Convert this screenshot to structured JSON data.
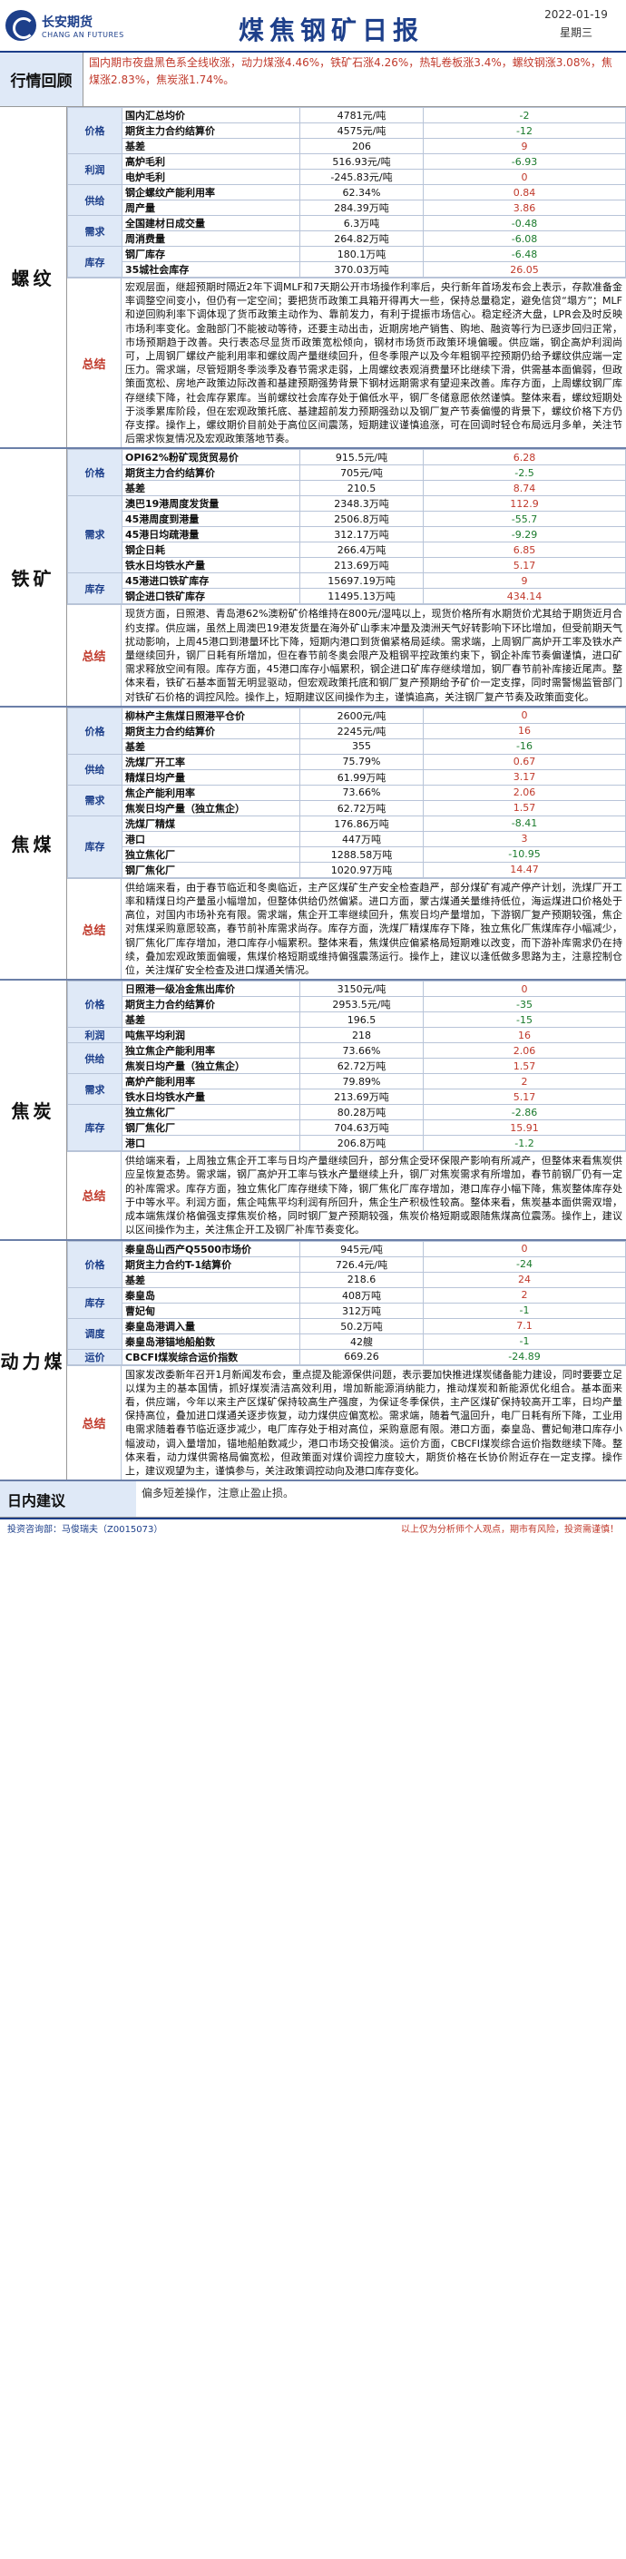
{
  "header": {
    "company_cn": "长安期货",
    "company_en": "CHANG AN FUTURES",
    "title": "煤焦钢矿日报",
    "date": "2022-01-19",
    "weekday": "星期三"
  },
  "review": {
    "label": "行情回顾",
    "text": "国内期市夜盘黑色系全线收涨，动力煤涨4.46%，铁矿石涨4.26%，热轧卷板涨3.4%，螺纹钢涨3.08%，焦煤涨2.83%，焦炭涨1.74%。"
  },
  "sections": [
    {
      "name": "螺纹",
      "rows": [
        {
          "cat": "价格",
          "name": "国内汇总均价",
          "value": "4781元/吨",
          "change": "-2"
        },
        {
          "cat": "价格",
          "name": "期货主力合约结算价",
          "value": "4575元/吨",
          "change": "-12"
        },
        {
          "cat": "价格",
          "name": "基差",
          "value": "206",
          "change": "9"
        },
        {
          "cat": "利润",
          "name": "高炉毛利",
          "value": "516.93元/吨",
          "change": "-6.93"
        },
        {
          "cat": "利润",
          "name": "电炉毛利",
          "value": "-245.83元/吨",
          "change": "0"
        },
        {
          "cat": "供给",
          "name": "钢企螺纹产能利用率",
          "value": "62.34%",
          "change": "0.84"
        },
        {
          "cat": "供给",
          "name": "周产量",
          "value": "284.39万吨",
          "change": "3.86"
        },
        {
          "cat": "需求",
          "name": "全国建材日成交量",
          "value": "6.3万吨",
          "change": "-0.48"
        },
        {
          "cat": "需求",
          "name": "周消费量",
          "value": "264.82万吨",
          "change": "-6.08"
        },
        {
          "cat": "库存",
          "name": "钢厂库存",
          "value": "180.1万吨",
          "change": "-6.48"
        },
        {
          "cat": "库存",
          "name": "35城社会库存",
          "value": "370.03万吨",
          "change": "26.05"
        }
      ],
      "summary_label": "总结",
      "summary": "宏观层面，继超预期时隔近2年下调MLF和7天期公开市场操作利率后，央行新年首场发布会上表示，存款准备金率调整空间变小，但仍有一定空间；要把货币政策工具箱开得再大一些，保持总量稳定，避免信贷“塌方”；MLF和逆回购利率下调体现了货币政策主动作为、靠前发力，有利于提振市场信心。稳定经济大盘，LPR会及时反映市场利率变化。金融部门不能被动等待，还要主动出击，近期房地产销售、购地、融资等行为已逐步回归正常，市场预期趋于改善。央行表态尽显货币政策宽松倾向，钢材市场货币政策环境偏暖。供应端，钢企高炉利润尚可，上周钢厂螺纹产能利用率和螺纹周产量继续回升，但冬季限产以及今年粗钢平控预期仍给予螺纹供应端一定压力。需求端，尽管短期冬季淡季及春节需求走弱，上周螺纹表观消费量环比继续下滑，供需基本面偏弱，但政策面宽松、房地产政策边际改善和基建预期强势背景下钢材远期需求有望迎来改善。库存方面，上周螺纹钢厂库存继续下降，社会库存累库。当前螺纹社会库存处于偏低水平，钢厂冬储意愿依然谨慎。整体来看，螺纹短期处于淡季累库阶段，但在宏观政策托底、基建超前发力预期强劲以及钢厂复产节奏偏慢的背景下，螺纹价格下方仍存支撑。操作上，螺纹期价目前处于高位区间震荡，短期建议谨慎追涨，可在回调时轻仓布局远月多单，关注节后需求恢复情况及宏观政策落地节奏。"
    },
    {
      "name": "铁矿",
      "rows": [
        {
          "cat": "价格",
          "name": "OPI62%粉矿现货贸易价",
          "value": "915.5元/吨",
          "change": "6.28"
        },
        {
          "cat": "价格",
          "name": "期货主力合约结算价",
          "value": "705元/吨",
          "change": "-2.5"
        },
        {
          "cat": "价格",
          "name": "基差",
          "value": "210.5",
          "change": "8.74"
        },
        {
          "cat": "需求",
          "name": "澳巴19港周度发货量",
          "value": "2348.3万吨",
          "change": "112.9"
        },
        {
          "cat": "需求",
          "name": "45港周度到港量",
          "value": "2506.8万吨",
          "change": "-55.7"
        },
        {
          "cat": "需求",
          "name": "45港日均疏港量",
          "value": "312.17万吨",
          "change": "-9.29"
        },
        {
          "cat": "需求",
          "name": "钢企日耗",
          "value": "266.4万吨",
          "change": "6.85"
        },
        {
          "cat": "需求",
          "name": "铁水日均铁水产量",
          "value": "213.69万吨",
          "change": "5.17"
        },
        {
          "cat": "库存",
          "name": "45港进口铁矿库存",
          "value": "15697.19万吨",
          "change": "9"
        },
        {
          "cat": "库存",
          "name": "钢企进口铁矿库存",
          "value": "11495.13万吨",
          "change": "434.14"
        }
      ],
      "summary_label": "总结",
      "summary": "现货方面，日照港、青岛港62%澳粉矿价格维持在800元/湿吨以上，现货价格所有水期货价尤其给于期货近月合约支撑。供应端，虽然上周澳巴19港发货量在海外矿山季末冲量及澳洲天气好转影响下环比增加，但受前期天气扰动影响，上周45港口到港量环比下降，短期内港口到货偏紧格局延续。需求端，上周钢厂高炉开工率及铁水产量继续回升，钢厂日耗有所增加，但在春节前冬奥会限产及粗钢平控政策约束下，钢企补库节奏偏谨慎，进口矿需求释放空间有限。库存方面，45港口库存小幅累积，钢企进口矿库存继续增加，钢厂春节前补库接近尾声。整体来看，铁矿石基本面暂无明显驱动，但宏观政策托底和钢厂复产预期给予矿价一定支撑，同时需警惕监管部门对铁矿石价格的调控风险。操作上，短期建议区间操作为主，谨慎追高，关注钢厂复产节奏及政策面变化。"
    },
    {
      "name": "焦煤",
      "rows": [
        {
          "cat": "价格",
          "name": "柳林产主焦煤日照港平仓价",
          "value": "2600元/吨",
          "change": "0"
        },
        {
          "cat": "价格",
          "name": "期货主力合约结算价",
          "value": "2245元/吨",
          "change": "16"
        },
        {
          "cat": "价格",
          "name": "基差",
          "value": "355",
          "change": "-16"
        },
        {
          "cat": "供给",
          "name": "洗煤厂开工率",
          "value": "75.79%",
          "change": "0.67"
        },
        {
          "cat": "供给",
          "name": "精煤日均产量",
          "value": "61.99万吨",
          "change": "3.17"
        },
        {
          "cat": "需求",
          "name": "焦企产能利用率",
          "value": "73.66%",
          "change": "2.06"
        },
        {
          "cat": "需求",
          "name": "焦炭日均产量（独立焦企）",
          "value": "62.72万吨",
          "change": "1.57"
        },
        {
          "cat": "库存",
          "name": "洗煤厂精煤",
          "value": "176.86万吨",
          "change": "-8.41"
        },
        {
          "cat": "库存",
          "name": "港口",
          "value": "447万吨",
          "change": "3"
        },
        {
          "cat": "库存",
          "name": "独立焦化厂",
          "value": "1288.58万吨",
          "change": "-10.95"
        },
        {
          "cat": "库存",
          "name": "钢厂焦化厂",
          "value": "1020.97万吨",
          "change": "14.47"
        }
      ],
      "summary_label": "总结",
      "summary": "供给端来看，由于春节临近和冬奥临近，主产区煤矿生产安全检查趋严，部分煤矿有减产停产计划，洗煤厂开工率和精煤日均产量虽小幅增加，但整体供给仍然偏紧。进口方面，蒙古煤通关量维持低位，海运煤进口价格处于高位，对国内市场补充有限。需求端，焦企开工率继续回升，焦炭日均产量增加，下游钢厂复产预期较强，焦企对焦煤采购意愿较高，春节前补库需求尚存。库存方面，洗煤厂精煤库存下降，独立焦化厂焦煤库存小幅减少，钢厂焦化厂库存增加，港口库存小幅累积。整体来看，焦煤供应偏紧格局短期难以改变，而下游补库需求仍在持续，叠加宏观政策面偏暖，焦煤价格短期或维持偏强震荡运行。操作上，建议以逢低做多思路为主，注意控制仓位，关注煤矿安全检查及进口煤通关情况。"
    },
    {
      "name": "焦炭",
      "rows": [
        {
          "cat": "价格",
          "name": "日照港一级冶金焦出库价",
          "value": "3150元/吨",
          "change": "0"
        },
        {
          "cat": "价格",
          "name": "期货主力合约结算价",
          "value": "2953.5元/吨",
          "change": "-35"
        },
        {
          "cat": "价格",
          "name": "基差",
          "value": "196.5",
          "change": "-15"
        },
        {
          "cat": "利润",
          "name": "吨焦平均利润",
          "value": "218",
          "change": "16"
        },
        {
          "cat": "供给",
          "name": "独立焦企产能利用率",
          "value": "73.66%",
          "change": "2.06"
        },
        {
          "cat": "供给",
          "name": "焦炭日均产量（独立焦企）",
          "value": "62.72万吨",
          "change": "1.57"
        },
        {
          "cat": "需求",
          "name": "高炉产能利用率",
          "value": "79.89%",
          "change": "2"
        },
        {
          "cat": "需求",
          "name": "铁水日均铁水产量",
          "value": "213.69万吨",
          "change": "5.17"
        },
        {
          "cat": "库存",
          "name": "独立焦化厂",
          "value": "80.28万吨",
          "change": "-2.86"
        },
        {
          "cat": "库存",
          "name": "钢厂焦化厂",
          "value": "704.63万吨",
          "change": "15.91"
        },
        {
          "cat": "库存",
          "name": "港口",
          "value": "206.8万吨",
          "change": "-1.2"
        }
      ],
      "summary_label": "总结",
      "summary": "供给端来看，上周独立焦企开工率与日均产量继续回升，部分焦企受环保限产影响有所减产，但整体来看焦炭供应呈恢复态势。需求端，钢厂高炉开工率与铁水产量继续上升，钢厂对焦炭需求有所增加，春节前钢厂仍有一定的补库需求。库存方面，独立焦化厂库存继续下降，钢厂焦化厂库存增加，港口库存小幅下降，焦炭整体库存处于中等水平。利润方面，焦企吨焦平均利润有所回升，焦企生产积极性较高。整体来看，焦炭基本面供需双增，成本端焦煤价格偏强支撑焦炭价格，同时钢厂复产预期较强，焦炭价格短期或跟随焦煤高位震荡。操作上，建议以区间操作为主，关注焦企开工及钢厂补库节奏变化。"
    },
    {
      "name": "动力煤",
      "rows": [
        {
          "cat": "价格",
          "name": "秦皇岛山西产Q5500市场价",
          "value": "945元/吨",
          "change": "0"
        },
        {
          "cat": "价格",
          "name": "期货主力合约T-1结算价",
          "value": "726.4元/吨",
          "change": "-24"
        },
        {
          "cat": "价格",
          "name": "基差",
          "value": "218.6",
          "change": "24"
        },
        {
          "cat": "库存",
          "name": "秦皇岛",
          "value": "408万吨",
          "change": "2"
        },
        {
          "cat": "库存",
          "name": "曹妃甸",
          "value": "312万吨",
          "change": "-1"
        },
        {
          "cat": "调度",
          "name": "秦皇岛港调入量",
          "value": "50.2万吨",
          "change": "7.1"
        },
        {
          "cat": "调度",
          "name": "秦皇岛港锚地船舶数",
          "value": "42艘",
          "change": "-1"
        },
        {
          "cat": "运价",
          "name": "CBCFI煤炭综合运价指数",
          "value": "669.26",
          "change": "-24.89"
        }
      ],
      "summary_label": "总结",
      "summary": "国家发改委新年召开1月新闻发布会，重点提及能源保供问题，表示要加快推进煤炭储备能力建设，同时要要立足以煤为主的基本国情，抓好煤炭清洁高效利用，增加新能源消纳能力，推动煤炭和新能源优化组合。基本面来看，供应端，今年以来主产区煤矿保持较高生产强度，为保证冬季保供，主产区煤矿保持较高开工率，日均产量保持高位，叠加进口煤通关逐步恢复，动力煤供应偏宽松。需求端，随着气温回升，电厂日耗有所下降，工业用电需求随着春节临近逐步减少，电厂库存处于相对高位，采购意愿有限。港口方面，秦皇岛、曹妃甸港口库存小幅波动，调入量增加，锚地船舶数减少，港口市场交投偏淡。运价方面，CBCFI煤炭综合运价指数继续下降。整体来看，动力煤供需格局偏宽松，但政策面对煤价调控力度较大，期货价格在长协价附近存在一定支撑。操作上，建议观望为主，谨慎参与，关注政策调控动向及港口库存变化。"
    }
  ],
  "daily": {
    "label": "日内建议",
    "text": "偏多短差操作，注意止盈止损。"
  },
  "footer": {
    "analyst": "投资咨询部：马俊瑞夫（Z0015073）",
    "disclaimer": "以上仅为分析师个人观点，期市有风险，投资需谨慎！"
  }
}
